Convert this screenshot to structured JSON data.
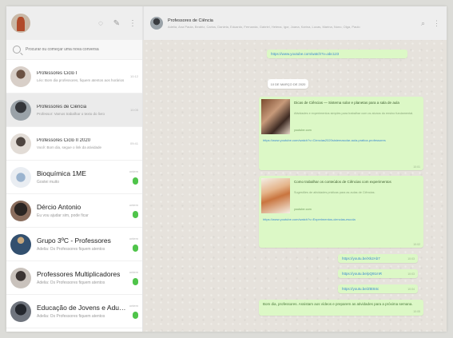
{
  "sidebar": {
    "search_placeholder": "Procurar ou começar uma nova conversa",
    "chats": [
      {
        "name": "Professores Ciclo I",
        "preview": "Léo: Bom dia professores, fiquem atentos aos horários",
        "time": "10:12",
        "unread": false,
        "active": false,
        "large": false
      },
      {
        "name": "Professores de Ciência",
        "preview": "Professor: Vamos trabalhar o texto do livro",
        "time": "10:05",
        "unread": false,
        "active": true,
        "large": false
      },
      {
        "name": "Professores Ciclo II 2020",
        "preview": "Você: Bom dia, segue o link da atividade",
        "time": "09:41",
        "unread": false,
        "active": false,
        "large": false
      },
      {
        "name": "Bioquímica 1ME",
        "preview": "Gostei muito",
        "time": "ontem",
        "unread": true,
        "active": false,
        "large": true
      },
      {
        "name": "Dércio Antonio",
        "preview": "Eu vou ajudar sim, pode ficar",
        "time": "ontem",
        "unread": true,
        "active": false,
        "large": true
      },
      {
        "name": "Grupo 3ºC - Professores",
        "preview": "Adelia: Os Professores fiquem atentos",
        "time": "ontem",
        "unread": true,
        "active": false,
        "large": true
      },
      {
        "name": "Professores Multiplicadores",
        "preview": "Adelia: Os Professores fiquem atentos",
        "time": "ontem",
        "unread": true,
        "active": false,
        "large": true
      },
      {
        "name": "Educação de Jovens e Adultos",
        "preview": "Adelia: Os Professores fiquem atentos",
        "time": "ontem",
        "unread": true,
        "active": false,
        "large": true
      }
    ]
  },
  "conversation": {
    "title": "Professores de Ciência",
    "subtitle": "Adelia, Ana Paula, Beatriz, Carlos, Daniela, Eduardo, Fernanda, Gabriel, Helena, Igor, Joana, Karina, Lucas, Marina, Nuno, Olga, Paulo",
    "date_chip": "10 DE MARÇO DE 2020",
    "top_message": "https://www.youtube.com/watch?v=abc123",
    "cards": [
      {
        "title": "Dicas de Ciências — Sistema solar e planetas para a sala de aula",
        "desc": "Atividades e experimentos simples para trabalhar com os alunos do ensino fundamental.",
        "site": "youtube.com",
        "link": "https://www.youtube.com/watch?v=Ciencias2020sistemasolar-aula-pratica-professores",
        "time": "10:01"
      },
      {
        "title": "Como trabalhar os conteúdos de Ciências com experimentos",
        "desc": "Sugestões de atividades práticas para as aulas de Ciências.",
        "site": "youtube.com",
        "link": "https://www.youtube.com/watch?v=Experimentos-ciencias-escola",
        "time": "10:02"
      }
    ],
    "short_links": [
      {
        "text": "https://youtu.be/Xk2Ab7",
        "time": "10:03"
      },
      {
        "text": "https://youtu.be/pQ91mR",
        "time": "10:03"
      },
      {
        "text": "https://youtu.be/ZtE84c",
        "time": "10:04"
      }
    ],
    "last_message": {
      "text": "Bom dia, professores. Assistam aos vídeos e preparem as atividades para a próxima semana.",
      "time": "10:05"
    }
  },
  "colors": {
    "unread_badge": "#4fc44a",
    "outgoing_bubble": "#dcf8c6",
    "chat_background": "#e6e2dc"
  }
}
